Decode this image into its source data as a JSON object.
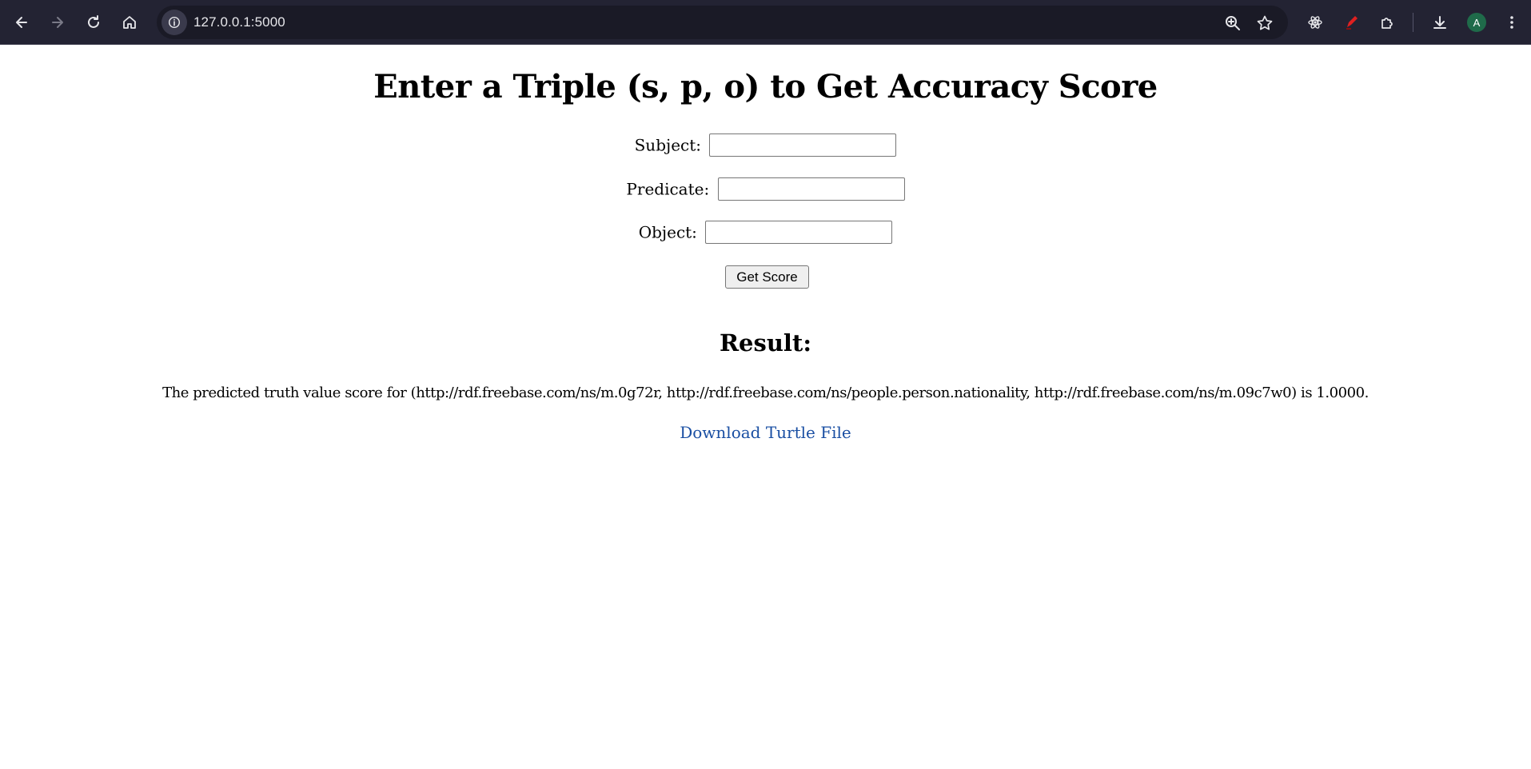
{
  "browser": {
    "url": "127.0.0.1:5000",
    "profile_initial": "A",
    "icons": [
      "back-icon",
      "forward-icon",
      "reload-icon",
      "home-icon",
      "site-info-icon",
      "zoom-icon",
      "bookmark-star-icon",
      "react-devtools-icon",
      "pen-extension-icon",
      "extensions-puzzle-icon",
      "download-icon",
      "menu-kebab-icon"
    ]
  },
  "page": {
    "title": "Enter a Triple (s, p, o) to Get Accuracy Score",
    "form": {
      "subject_label": "Subject:",
      "subject_value": "",
      "predicate_label": "Predicate:",
      "predicate_value": "",
      "object_label": "Object:",
      "object_value": "",
      "submit_label": "Get Score"
    },
    "result": {
      "heading": "Result:",
      "text": "The predicted truth value score for (http://rdf.freebase.com/ns/m.0g72r, http://rdf.freebase.com/ns/people.person.nationality, http://rdf.freebase.com/ns/m.09c7w0) is 1.0000.",
      "download_link": "Download Turtle File"
    }
  },
  "colors": {
    "toolbar_bg": "#232333",
    "omnibox_bg": "#1a1a26",
    "link": "#1a4fa3",
    "avatar_bg": "#1f6b4a"
  }
}
